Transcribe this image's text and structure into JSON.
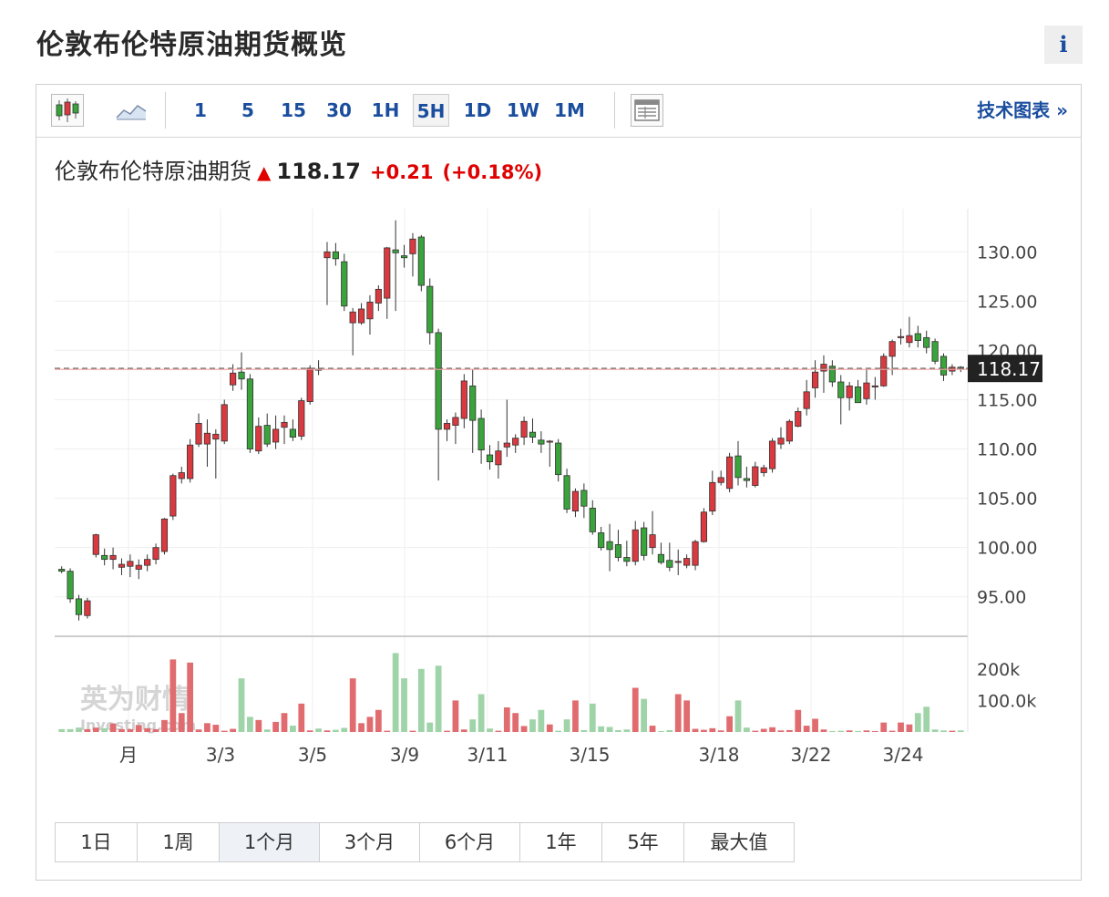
{
  "page_title": "伦敦布伦特原油期货概览",
  "info_label": "i",
  "toolbar": {
    "intervals": [
      "1",
      "5",
      "15",
      "30",
      "1H",
      "5H",
      "1D",
      "1W",
      "1M"
    ],
    "active_interval": "5H",
    "tech_chart_label": "技术图表 »"
  },
  "quote": {
    "name": "伦敦布伦特原油期货",
    "price": "118.17",
    "change": "+0.21",
    "change_pct": "(+0.18%)",
    "direction": "up"
  },
  "ranges": [
    "1日",
    "1周",
    "1个月",
    "3个月",
    "6个月",
    "1年",
    "5年",
    "最大值"
  ],
  "active_range": "1个月",
  "colors": {
    "up": "#d9393f",
    "down": "#3aa33c",
    "vol_up": "#e06c70",
    "vol_down": "#9fd3a8",
    "link": "#1a4d9e",
    "last_price_bg": "#222222"
  },
  "chart_data": {
    "type": "candlestick",
    "price_axis": {
      "ticks": [
        "130.00",
        "125.00",
        "120.00",
        "115.00",
        "110.00",
        "105.00",
        "100.00",
        "95.00"
      ],
      "range": [
        91,
        134
      ]
    },
    "volume_axis": {
      "ticks": [
        "200k",
        "100.0k"
      ],
      "range": [
        0,
        260000
      ]
    },
    "x_labels": [
      "月",
      "3/3",
      "3/5",
      "3/9",
      "3/11",
      "3/15",
      "3/18",
      "3/22",
      "3/24"
    ],
    "last_price": "118.17",
    "reference_line": 118.0,
    "ohlc": [
      [
        97.8,
        98.1,
        97.4,
        97.6
      ],
      [
        97.6,
        97.9,
        94.4,
        94.8
      ],
      [
        94.8,
        95.2,
        92.6,
        93.2
      ],
      [
        93.1,
        94.9,
        92.8,
        94.6
      ],
      [
        99.3,
        101.4,
        99.0,
        101.3
      ],
      [
        99.2,
        99.9,
        98.2,
        98.8
      ],
      [
        98.8,
        100.0,
        97.8,
        99.2
      ],
      [
        98.0,
        98.9,
        97.2,
        98.3
      ],
      [
        98.1,
        99.3,
        97.0,
        98.6
      ],
      [
        97.8,
        98.8,
        96.8,
        98.2
      ],
      [
        98.2,
        99.3,
        97.6,
        98.8
      ],
      [
        98.8,
        100.4,
        98.3,
        100.0
      ],
      [
        99.6,
        103.0,
        99.3,
        102.9
      ],
      [
        103.2,
        107.5,
        102.8,
        107.3
      ],
      [
        107.0,
        108.2,
        106.5,
        107.6
      ],
      [
        107.0,
        111.0,
        106.6,
        110.4
      ],
      [
        110.5,
        113.6,
        110.2,
        112.6
      ],
      [
        110.5,
        113.0,
        108.2,
        111.6
      ],
      [
        111.0,
        112.0,
        107.0,
        111.5
      ],
      [
        110.8,
        115.0,
        110.5,
        114.5
      ],
      [
        116.5,
        118.6,
        115.9,
        117.7
      ],
      [
        117.8,
        119.8,
        116.0,
        117.1
      ],
      [
        117.1,
        117.6,
        109.6,
        110.0
      ],
      [
        109.8,
        113.2,
        109.5,
        112.3
      ],
      [
        112.4,
        113.6,
        110.2,
        110.5
      ],
      [
        110.7,
        113.4,
        110.0,
        112.0
      ],
      [
        112.2,
        113.4,
        110.5,
        112.7
      ],
      [
        112.0,
        113.0,
        110.8,
        111.2
      ],
      [
        111.3,
        115.2,
        110.9,
        114.9
      ],
      [
        114.8,
        118.5,
        114.5,
        118.2
      ],
      [
        118.1,
        119.0,
        117.5,
        118.0
      ],
      [
        129.4,
        131.0,
        124.6,
        130.0
      ],
      [
        130.0,
        130.9,
        128.6,
        129.3
      ],
      [
        129.0,
        129.8,
        124.0,
        124.5
      ],
      [
        122.8,
        124.3,
        119.5,
        123.9
      ],
      [
        122.8,
        124.8,
        122.6,
        124.2
      ],
      [
        123.2,
        125.6,
        121.6,
        124.9
      ],
      [
        124.8,
        126.6,
        124.0,
        126.2
      ],
      [
        125.3,
        130.5,
        123.2,
        130.4
      ],
      [
        130.2,
        133.2,
        124.0,
        129.9
      ],
      [
        129.6,
        130.7,
        128.4,
        129.4
      ],
      [
        129.8,
        131.9,
        127.5,
        131.3
      ],
      [
        131.5,
        131.7,
        126.0,
        126.6
      ],
      [
        126.5,
        127.3,
        120.6,
        121.8
      ],
      [
        121.8,
        122.2,
        106.8,
        112.0
      ],
      [
        112.0,
        113.0,
        110.8,
        112.6
      ],
      [
        112.4,
        113.7,
        110.5,
        113.2
      ],
      [
        113.1,
        117.6,
        112.1,
        116.9
      ],
      [
        116.4,
        118.1,
        109.6,
        112.9
      ],
      [
        113.1,
        114.0,
        108.5,
        109.9
      ],
      [
        109.4,
        110.4,
        107.9,
        108.7
      ],
      [
        108.4,
        110.8,
        107.0,
        109.8
      ],
      [
        110.2,
        115.0,
        109.2,
        110.6
      ],
      [
        110.4,
        111.5,
        109.6,
        111.1
      ],
      [
        111.2,
        113.3,
        110.4,
        112.8
      ],
      [
        111.7,
        113.1,
        110.6,
        111.2
      ],
      [
        110.9,
        111.8,
        109.6,
        110.5
      ],
      [
        110.7,
        110.9,
        108.2,
        110.8
      ],
      [
        110.6,
        111.0,
        106.7,
        107.4
      ],
      [
        107.3,
        108.0,
        103.5,
        103.9
      ],
      [
        103.7,
        106.0,
        103.1,
        105.7
      ],
      [
        105.8,
        106.5,
        103.0,
        104.2
      ],
      [
        104.0,
        104.8,
        101.3,
        101.6
      ],
      [
        101.5,
        102.1,
        99.7,
        100.0
      ],
      [
        100.6,
        102.4,
        97.6,
        99.8
      ],
      [
        100.3,
        101.8,
        98.6,
        99.0
      ],
      [
        99.0,
        100.7,
        98.1,
        98.6
      ],
      [
        98.6,
        102.7,
        98.2,
        101.8
      ],
      [
        102.0,
        102.6,
        98.7,
        99.2
      ],
      [
        100.0,
        103.7,
        99.3,
        101.3
      ],
      [
        99.3,
        100.5,
        98.3,
        98.5
      ],
      [
        98.7,
        100.5,
        97.6,
        98.0
      ],
      [
        98.5,
        99.8,
        97.2,
        98.6
      ],
      [
        98.2,
        99.3,
        97.9,
        98.9
      ],
      [
        98.2,
        100.8,
        97.7,
        100.6
      ],
      [
        100.6,
        104.0,
        100.5,
        103.6
      ],
      [
        103.7,
        107.8,
        103.3,
        106.6
      ],
      [
        106.6,
        107.8,
        106.3,
        107.1
      ],
      [
        106.0,
        109.6,
        105.6,
        109.2
      ],
      [
        109.3,
        110.8,
        106.3,
        107.1
      ],
      [
        107.0,
        108.2,
        106.1,
        106.8
      ],
      [
        106.3,
        108.7,
        106.1,
        108.2
      ],
      [
        107.6,
        108.4,
        107.2,
        108.1
      ],
      [
        108.0,
        111.1,
        107.6,
        110.8
      ],
      [
        110.5,
        112.2,
        110.0,
        111.1
      ],
      [
        110.8,
        113.0,
        110.5,
        112.8
      ],
      [
        112.3,
        114.2,
        112.2,
        113.8
      ],
      [
        114.1,
        117.0,
        113.4,
        115.8
      ],
      [
        116.2,
        119.0,
        115.2,
        117.8
      ],
      [
        117.9,
        119.5,
        115.7,
        118.6
      ],
      [
        118.4,
        119.0,
        116.3,
        116.8
      ],
      [
        116.8,
        117.5,
        112.5,
        115.2
      ],
      [
        115.2,
        116.8,
        113.9,
        116.4
      ],
      [
        116.3,
        117.0,
        114.7,
        114.7
      ],
      [
        115.1,
        118.1,
        114.5,
        116.7
      ],
      [
        116.4,
        117.3,
        115.0,
        116.4
      ],
      [
        116.4,
        119.7,
        116.3,
        119.4
      ],
      [
        119.4,
        121.1,
        117.5,
        120.9
      ],
      [
        121.3,
        122.2,
        120.6,
        121.4
      ],
      [
        120.8,
        123.4,
        120.3,
        121.5
      ],
      [
        121.7,
        122.5,
        120.3,
        121.0
      ],
      [
        121.3,
        122.0,
        119.7,
        120.3
      ],
      [
        120.9,
        121.2,
        118.6,
        118.9
      ],
      [
        119.4,
        119.7,
        116.9,
        117.5
      ],
      [
        117.9,
        118.6,
        117.5,
        118.3
      ],
      [
        118.3,
        118.4,
        117.8,
        118.17
      ]
    ],
    "volumes": [
      9000,
      9000,
      14000,
      9000,
      14000,
      12000,
      27000,
      9000,
      9000,
      22000,
      12000,
      9000,
      38000,
      230000,
      60000,
      220000,
      8000,
      28000,
      23000,
      4000,
      10000,
      170000,
      48000,
      38000,
      8000,
      32000,
      60000,
      20000,
      90000,
      5000,
      11000,
      5000,
      7000,
      13000,
      170000,
      28000,
      48000,
      70000,
      4000,
      250000,
      170000,
      4000,
      200000,
      30000,
      210000,
      4000,
      100000,
      8000,
      40000,
      120000,
      11000,
      4000,
      78000,
      60000,
      19000,
      40000,
      70000,
      24000,
      4000,
      40000,
      100000,
      6000,
      90000,
      18000,
      16000,
      6000,
      8000,
      140000,
      105000,
      20000,
      3000,
      6000,
      120000,
      100000,
      10000,
      7000,
      12000,
      5000,
      50000,
      100000,
      14000,
      4000,
      10000,
      15000,
      5000,
      6000,
      70000,
      20000,
      42000,
      8000,
      3000,
      4000,
      5000,
      3000,
      5000,
      3000,
      30000,
      4000,
      30000,
      24000,
      60000,
      80000,
      8000,
      5000,
      4000,
      5000
    ]
  }
}
